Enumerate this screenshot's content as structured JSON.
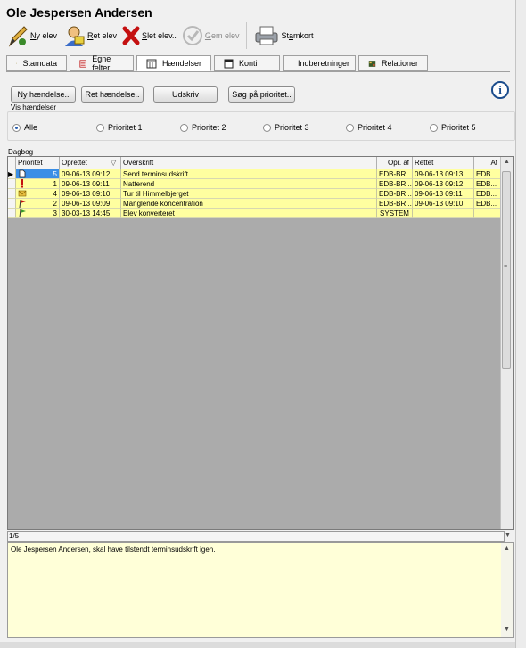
{
  "title": "Ole Jespersen Andersen",
  "toolbar": {
    "new_pre": "",
    "new_u": "N",
    "new_post": "y elev",
    "edit_pre": "",
    "edit_u": "R",
    "edit_post": "et elev",
    "delete_pre": "",
    "delete_u": "S",
    "delete_post": "let elev..",
    "save_pre": "",
    "save_u": "G",
    "save_post": "em elev",
    "card_pre": "St",
    "card_u": "a",
    "card_post": "mkort"
  },
  "tabs": [
    {
      "label": "Stamdata"
    },
    {
      "label": "Egne felter"
    },
    {
      "label": "Hændelser"
    },
    {
      "label": "Konti"
    },
    {
      "label": "Indberetninger"
    },
    {
      "label": "Relationer"
    }
  ],
  "actions": {
    "new_event": "Ny hændelse..",
    "edit_event": "Ret hændelse..",
    "print": "Udskriv",
    "search_priority": "Søg på prioritet.."
  },
  "info_glyph": "i",
  "filter": {
    "group_label": "Vis hændelser",
    "options": [
      "Alle",
      "Prioritet 1",
      "Prioritet 2",
      "Prioritet 3",
      "Prioritet 4",
      "Prioritet 5"
    ],
    "selected": "Alle"
  },
  "diary": {
    "group_label": "Dagbog",
    "columns": [
      "Prioritet",
      "Oprettet",
      "Overskrift",
      "Opr. af",
      "Rettet",
      "Af"
    ],
    "sort_glyph": "▽",
    "rows": [
      {
        "icon": "document-icon",
        "priority": "5",
        "created": "09-06-13 09:12",
        "heading": "Send terminsudskrift",
        "created_by": "EDB-BR...",
        "modified": "09-06-13 09:13",
        "by": "EDB..."
      },
      {
        "icon": "exclamation-icon",
        "priority": "1",
        "created": "09-06-13 09:11",
        "heading": "Natterend",
        "created_by": "EDB-BR...",
        "modified": "09-06-13 09:12",
        "by": "EDB..."
      },
      {
        "icon": "envelope-icon",
        "priority": "4",
        "created": "09-06-13 09:10",
        "heading": "Tur til Himmelbjerget",
        "created_by": "EDB-BR...",
        "modified": "09-06-13 09:11",
        "by": "EDB..."
      },
      {
        "icon": "flag-red-icon",
        "priority": "2",
        "created": "09-06-13 09:09",
        "heading": "Manglende koncentration",
        "created_by": "EDB-BR...",
        "modified": "09-06-13 09:10",
        "by": "EDB..."
      },
      {
        "icon": "flag-green-icon",
        "priority": "3",
        "created": "30-03-13 14:45",
        "heading": "Elev konverteret",
        "created_by": "SYSTEM",
        "modified": "",
        "by": ""
      }
    ]
  },
  "status": "1/5",
  "memo": "Ole Jespersen Andersen, skal have tilstendt terminsudskrift igen.",
  "colors": {
    "row_bg": "#ffffa0",
    "selected": "#3a8ee6",
    "grid_bg": "#ababab",
    "memo_bg": "#ffffd8"
  }
}
